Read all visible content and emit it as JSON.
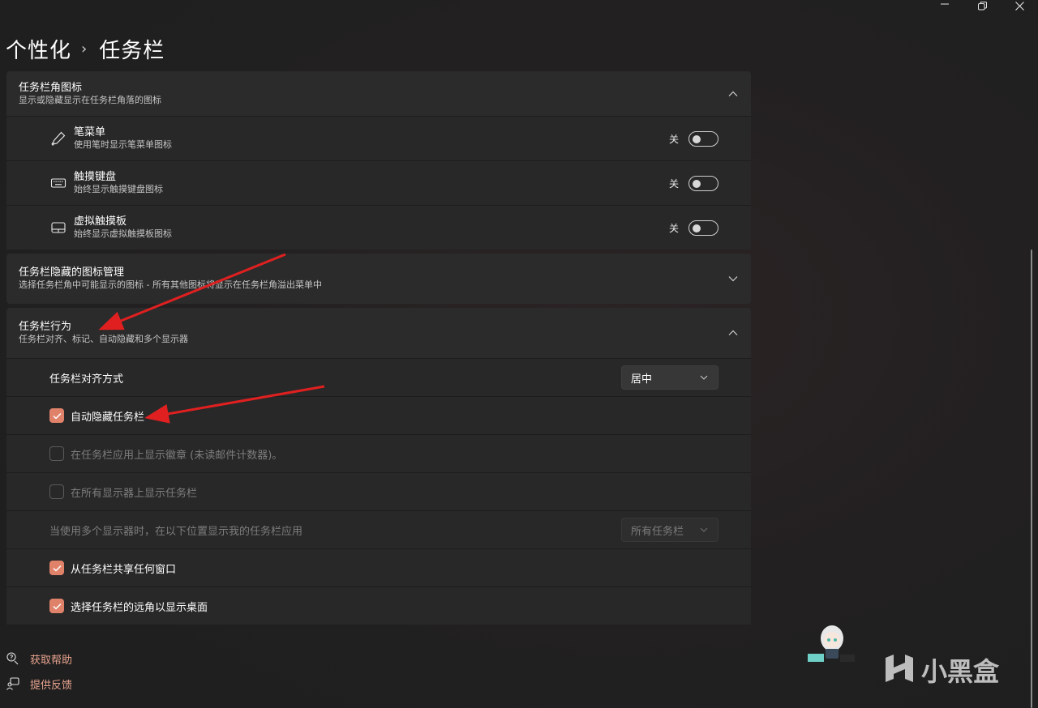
{
  "window": {
    "minimize_icon": "minimize-icon",
    "maximize_icon": "restore-icon",
    "close_icon": "close-icon"
  },
  "breadcrumb": {
    "parent": "个性化",
    "separator": "›",
    "current": "任务栏"
  },
  "corner_icons_section": {
    "title": "任务栏角图标",
    "subtitle": "显示或隐藏显示在任务栏角落的图标",
    "expanded": true,
    "items": [
      {
        "icon": "pen-icon",
        "title": "笔菜单",
        "subtitle": "使用笔时显示笔菜单图标",
        "toggle_label": "关",
        "on": false
      },
      {
        "icon": "keyboard-icon",
        "title": "触摸键盘",
        "subtitle": "始终显示触摸键盘图标",
        "toggle_label": "关",
        "on": false
      },
      {
        "icon": "touchpad-icon",
        "title": "虚拟触摸板",
        "subtitle": "始终显示虚拟触摸板图标",
        "toggle_label": "关",
        "on": false
      }
    ]
  },
  "hidden_icons_section": {
    "title": "任务栏隐藏的图标管理",
    "subtitle": "选择任务栏角中可能显示的图标 - 所有其他图标将显示在任务栏角溢出菜单中",
    "expanded": false
  },
  "behavior_section": {
    "title": "任务栏行为",
    "subtitle": "任务栏对齐、标记、自动隐藏和多个显示器",
    "expanded": true,
    "alignment": {
      "label": "任务栏对齐方式",
      "value": "居中"
    },
    "auto_hide": {
      "label": "自动隐藏任务栏",
      "checked": true,
      "enabled": true
    },
    "badges": {
      "label": "在任务栏应用上显示徽章 (未读邮件计数器)。",
      "checked": false,
      "enabled": false
    },
    "all_displays": {
      "label": "在所有显示器上显示任务栏",
      "checked": false,
      "enabled": false
    },
    "multi_display": {
      "label": "当使用多个显示器时，在以下位置显示我的任务栏应用",
      "value": "所有任务栏",
      "enabled": false
    },
    "share_window": {
      "label": "从任务栏共享任何窗口",
      "checked": true,
      "enabled": true
    },
    "far_corner": {
      "label": "选择任务栏的远角以显示桌面",
      "checked": true,
      "enabled": true
    }
  },
  "footer": {
    "help": {
      "icon": "help-icon",
      "label": "获取帮助"
    },
    "feedback": {
      "icon": "feedback-icon",
      "label": "提供反馈"
    }
  },
  "watermark": {
    "text": "小黑盒"
  },
  "colors": {
    "accent": "#e0826a",
    "link": "#e8a48f",
    "arrow": "#e02020"
  }
}
